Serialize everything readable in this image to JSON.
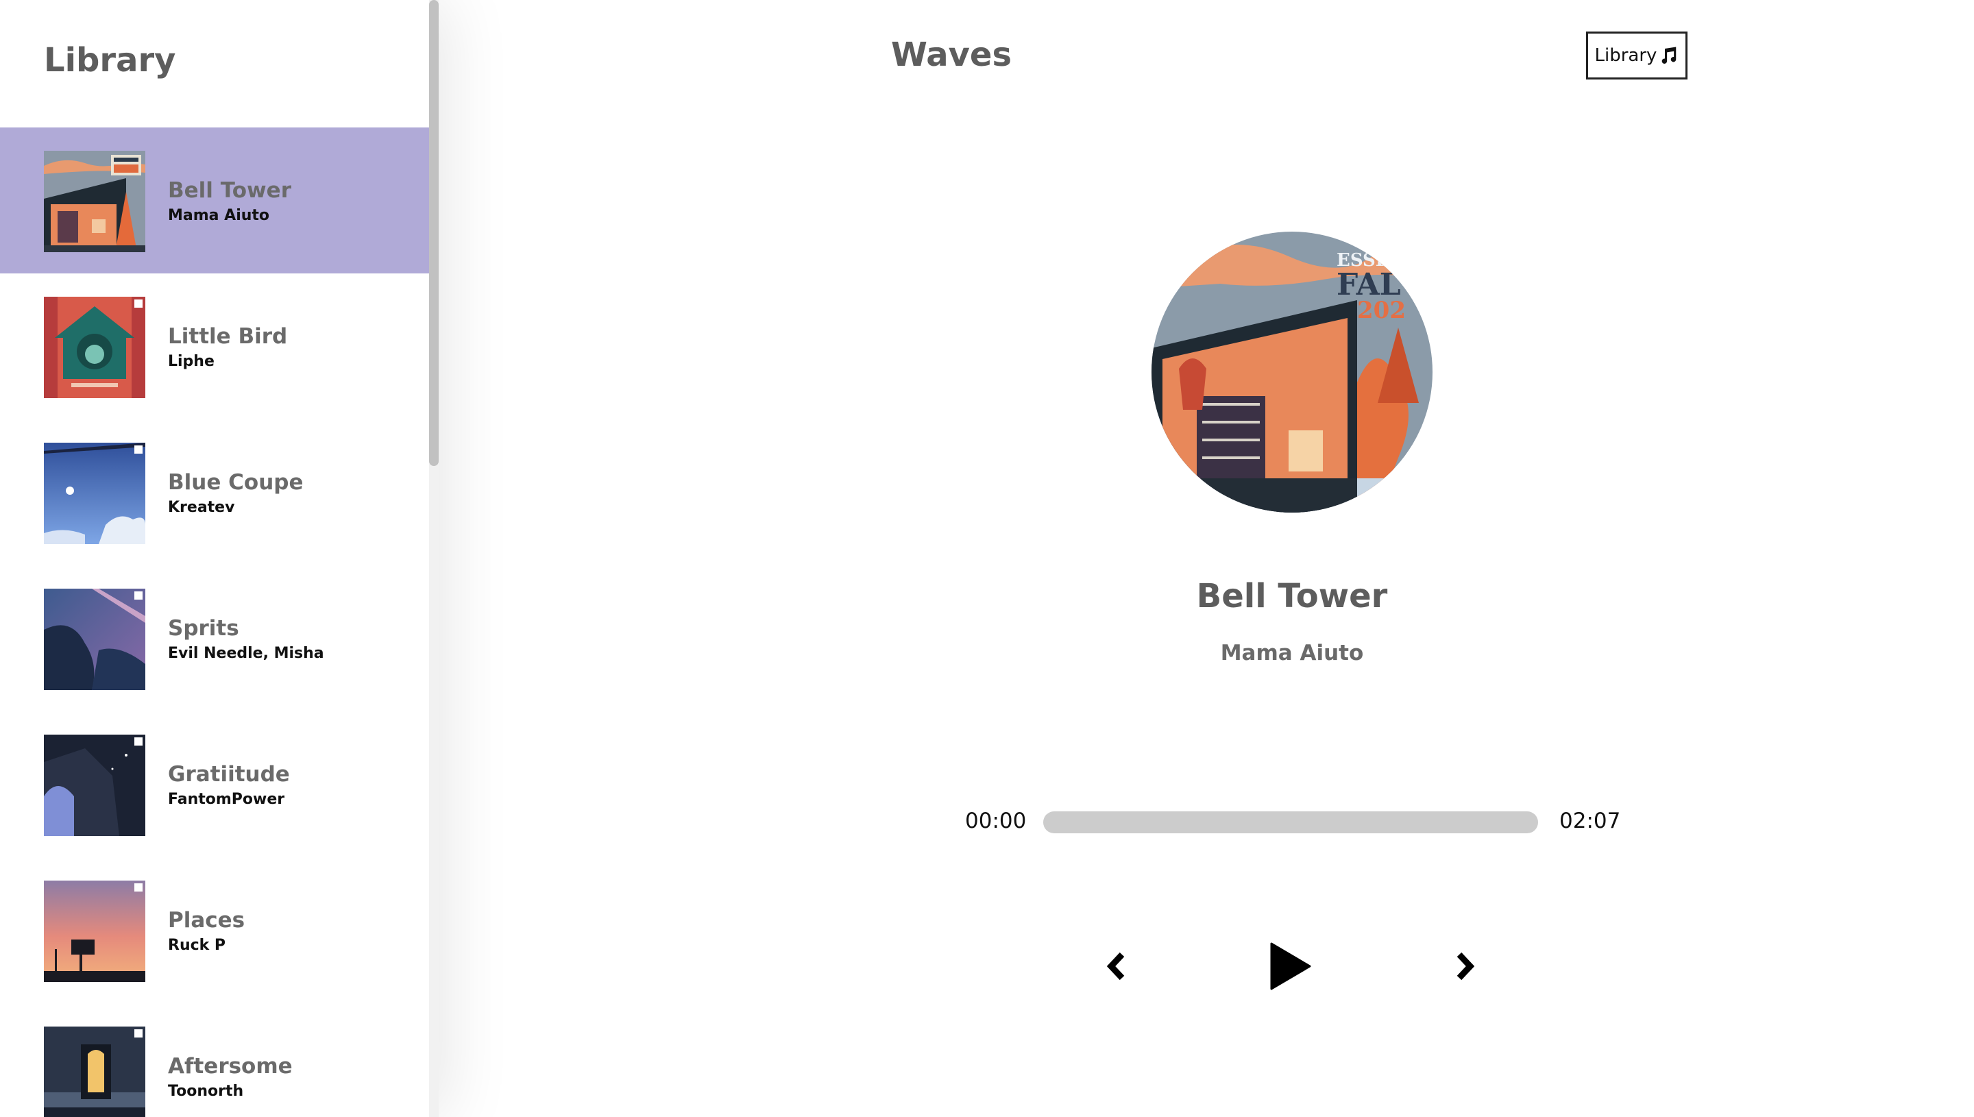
{
  "sidebar": {
    "title": "Library",
    "songs": [
      {
        "name": "Bell Tower",
        "artist": "Mama Aiuto",
        "selected": true
      },
      {
        "name": "Little Bird",
        "artist": "Liphe",
        "selected": false
      },
      {
        "name": "Blue Coupe",
        "artist": "Kreatev",
        "selected": false
      },
      {
        "name": "Sprits",
        "artist": "Evil Needle, Misha",
        "selected": false
      },
      {
        "name": "Gratiitude",
        "artist": "FantomPower",
        "selected": false
      },
      {
        "name": "Places",
        "artist": "Ruck P",
        "selected": false
      },
      {
        "name": "Aftersome",
        "artist": "Toonorth",
        "selected": false
      }
    ]
  },
  "header": {
    "title": "Waves",
    "library_button_label": "Library",
    "library_button_icon": "music-note-icon"
  },
  "now_playing": {
    "title": "Bell Tower",
    "artist": "Mama Aiuto",
    "cover_text_line1": "ESSEN",
    "cover_text_line2": "FAL",
    "cover_text_line3": "202"
  },
  "player": {
    "current_time": "00:00",
    "total_time": "02:07",
    "progress": 0,
    "controls": [
      "chevron-left-icon",
      "play-icon",
      "chevron-right-icon"
    ]
  },
  "colors": {
    "selected_bg": "#b0aad7",
    "title_text": "#5d5d5d",
    "progress_track": "#cccccc"
  }
}
